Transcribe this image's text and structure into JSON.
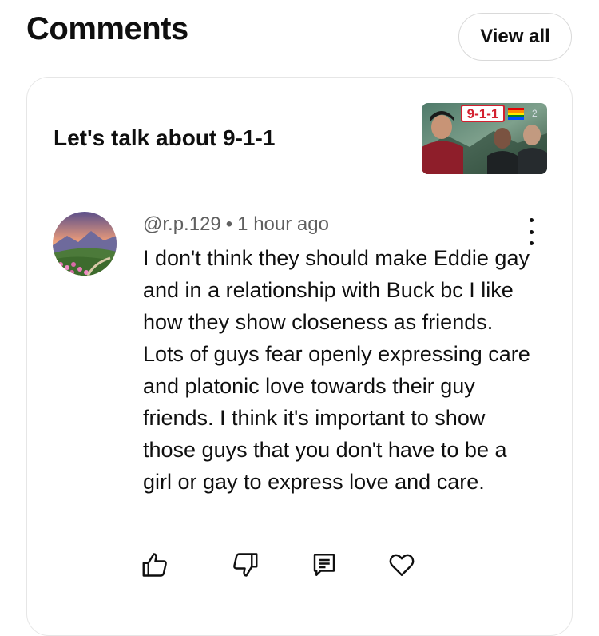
{
  "header": {
    "title": "Comments",
    "view_all_label": "View all"
  },
  "card": {
    "video_title": "Let's talk about 9-1-1",
    "thumbnail": {
      "logo_text": "9-1-1",
      "badge_text": "2"
    },
    "comment": {
      "author": "@r.p.129",
      "separator": "•",
      "timestamp": "1 hour ago",
      "text": "I don't think they should make Eddie gay and in a relationship with Buck bc I like how they show closeness as friends. Lots of guys fear openly expressing care and platonic love towards their guy friends. I think it's important to show those guys that you don't have to be a girl or gay to express love and care."
    },
    "actions": [
      {
        "name": "like",
        "icon": "thumbs-up-icon"
      },
      {
        "name": "dislike",
        "icon": "thumbs-down-icon"
      },
      {
        "name": "reply",
        "icon": "comment-icon"
      },
      {
        "name": "heart",
        "icon": "heart-icon"
      }
    ]
  }
}
